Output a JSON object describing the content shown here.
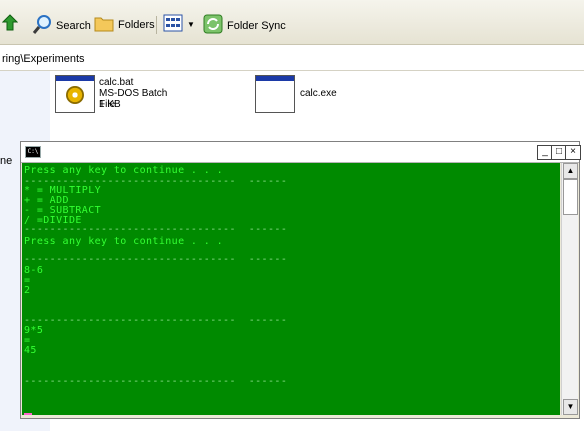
{
  "toolbar": {
    "search_label": "Search",
    "folders_label": "Folders",
    "folder_sync_label": "Folder Sync"
  },
  "address": {
    "path": "ring\\Experiments"
  },
  "left_pane": {
    "text": "ne"
  },
  "files": [
    {
      "name": "calc.bat",
      "type": "MS-DOS Batch File",
      "size": "1 KB"
    },
    {
      "name": "calc.exe"
    }
  ],
  "console": {
    "lines": [
      "Press any key to continue . . .",
      "---------------------------------  ------",
      "* = MULTIPLY",
      "+ = ADD",
      "- = SUBTRACT",
      "/ =DIVIDE",
      "---------------------------------  ------",
      "Press any key to continue . . .",
      "---------------------------------  ------",
      "8-6",
      "=",
      "2",
      "---------------------------------  ------",
      "9*5",
      "=",
      "45",
      "---------------------------------  ------"
    ],
    "buttons": {
      "minimize": "_",
      "maximize": "□",
      "close": "×"
    },
    "colors": {
      "background": "#008a00",
      "text": "#33ff33",
      "cursor": "#ff66cc"
    }
  }
}
